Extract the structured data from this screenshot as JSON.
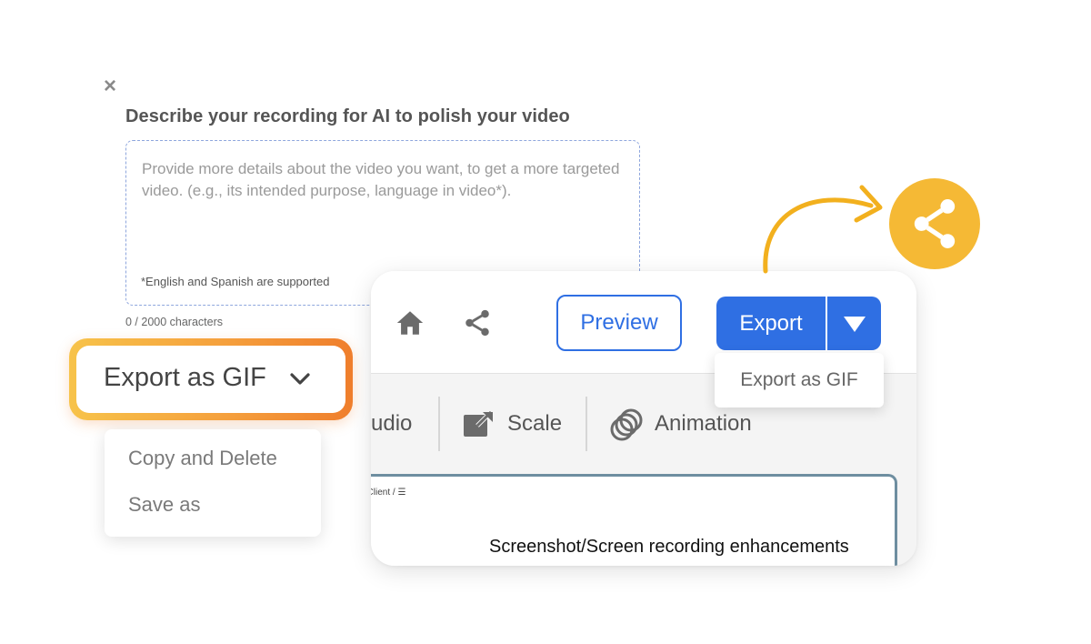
{
  "describe": {
    "close_symbol": "×",
    "title": "Describe your recording for AI to polish your video",
    "placeholder": "Provide more details about the video you want, to get a more targeted video. (e.g., its intended purpose, language in video*).",
    "note": "*English and Spanish are supported",
    "char_count": "0 / 2000 characters"
  },
  "editor": {
    "preview_label": "Preview",
    "export_label": "Export",
    "export_dropdown_item": "Export as GIF",
    "tools": {
      "audio": "udio",
      "scale": "Scale",
      "animation": "Animation"
    },
    "breadcrumb": "/  Client  /    ☰",
    "frame_title": "Screenshot/Screen recording enhancements"
  },
  "gif_select": {
    "label": "Export as GIF"
  },
  "file_menu": {
    "items": [
      "Copy and Delete",
      "Save as"
    ]
  },
  "icons": {
    "close": "close-icon",
    "home": "home-icon",
    "share": "share-icon",
    "scale": "scale-icon",
    "animation": "animation-icon",
    "chevron": "chevron-down-icon",
    "caret": "caret-down-icon"
  },
  "colors": {
    "primary_blue": "#2f6fe3",
    "share_yellow": "#f5b935",
    "gradient_start": "#f7c34a",
    "gradient_end": "#ef7e2c"
  }
}
